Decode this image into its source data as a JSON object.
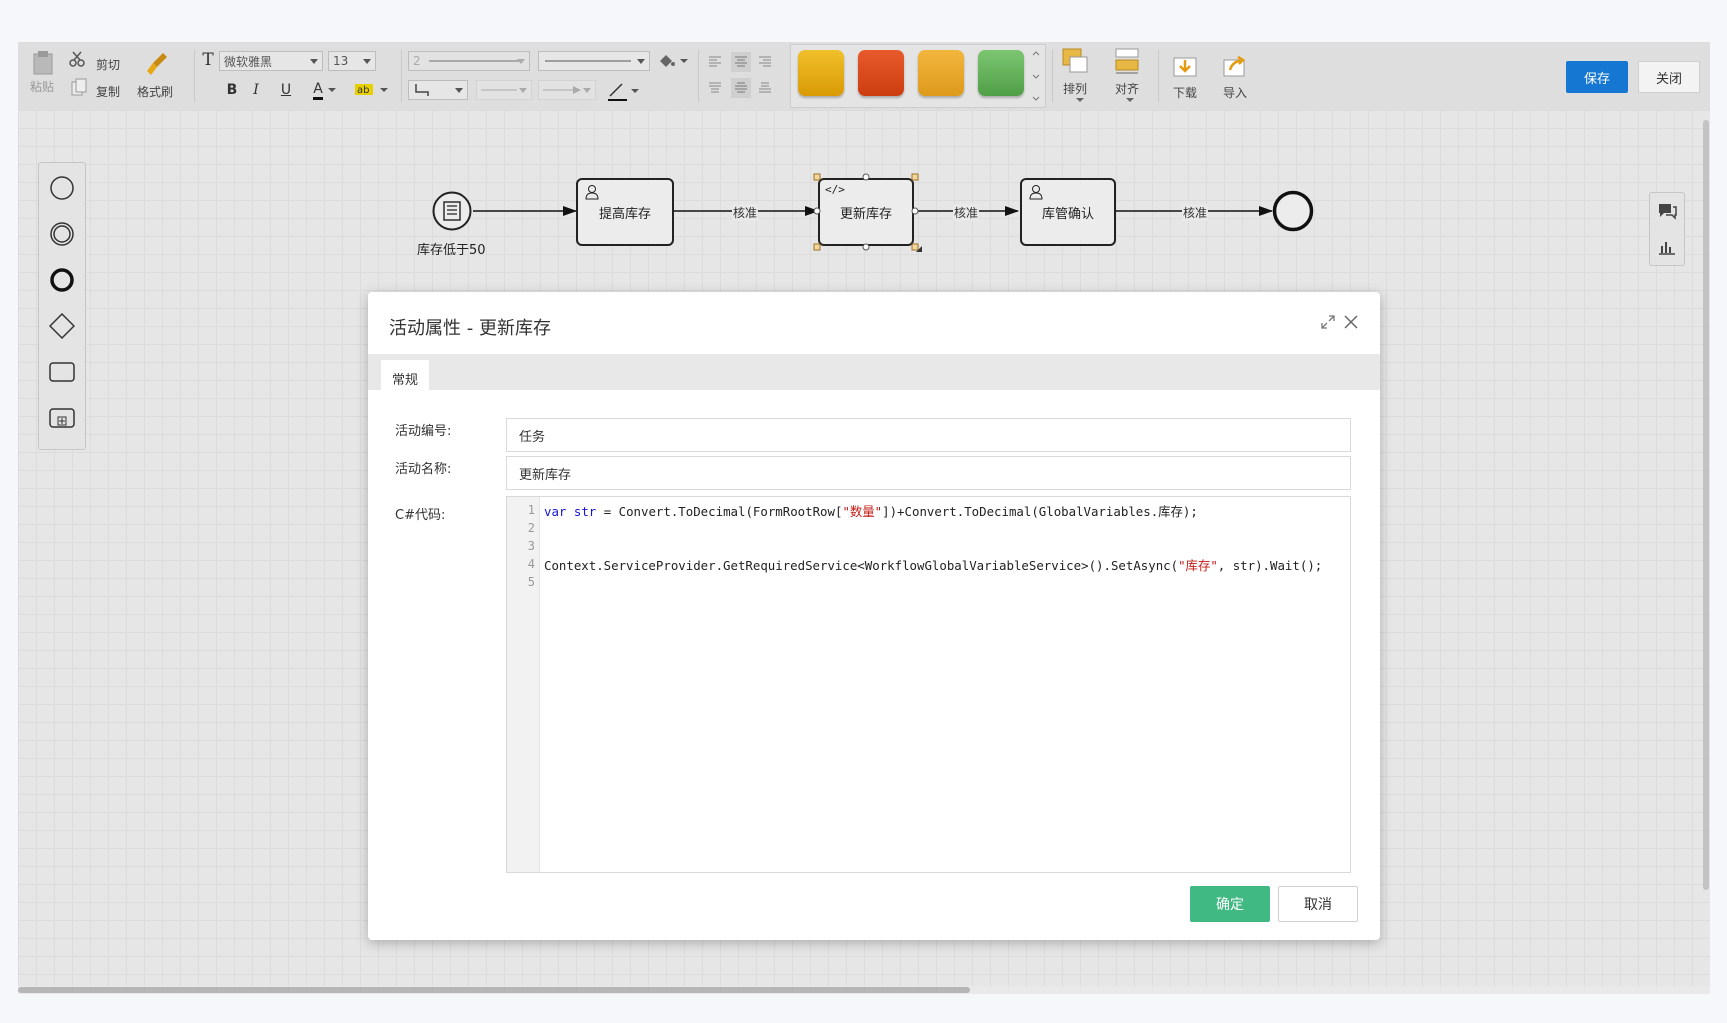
{
  "toolbar": {
    "paste": "粘贴",
    "cut": "剪切",
    "copy": "复制",
    "format_painter": "格式刷",
    "font_family": "微软雅黑",
    "font_size": "13",
    "line_width": "2",
    "bold": "B",
    "italic": "I",
    "underline": "U",
    "font_color": "A",
    "arrange": "排列",
    "align": "对齐",
    "download": "下载",
    "import": "导入",
    "save": "保存",
    "close": "关闭",
    "swatches": [
      "#e6a813",
      "#d9481e",
      "#e7a32c",
      "#5fae57"
    ]
  },
  "diagram": {
    "start_label": "库存低于50",
    "task1": "提高库存",
    "task2": "更新库存",
    "task3": "库管确认",
    "edge1": "核准",
    "edge2": "核准",
    "edge3": "核准"
  },
  "dialog": {
    "title": "活动属性 - 更新库存",
    "tab": "常规",
    "id_label": "活动编号:",
    "id_value": "任务",
    "name_label": "活动名称:",
    "name_value": "更新库存",
    "code_label": "C#代码:",
    "line_numbers": [
      "1",
      "2",
      "3",
      "4",
      "5"
    ],
    "code_line1": {
      "kw1": "var",
      "var1": "str",
      "mid": " = Convert.ToDecimal(FormRootRow[",
      "s1": "\"数量\"",
      "tail": "])+Convert.ToDecimal(GlobalVariables.库存);"
    },
    "code_line4": {
      "head": "Context.ServiceProvider.GetRequiredService<WorkflowGlobalVariableService>().SetAsync(",
      "s1": "\"库存\"",
      "tail": ", str).Wait();"
    },
    "ok": "确定",
    "cancel": "取消"
  }
}
